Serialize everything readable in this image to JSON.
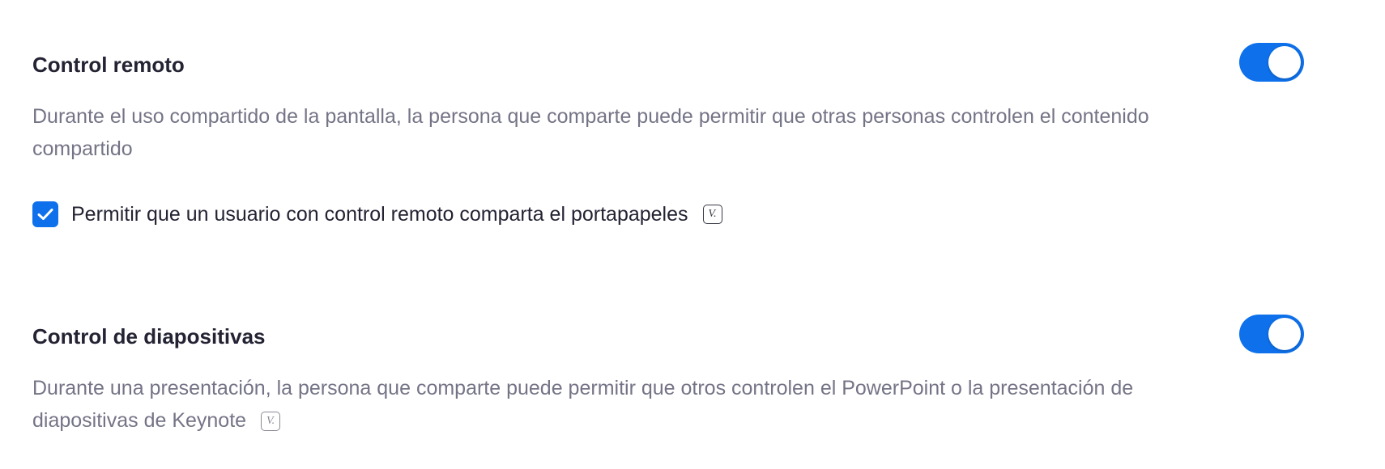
{
  "settings": [
    {
      "title": "Control remoto",
      "description": "Durante el uso compartido de la pantalla, la persona que comparte puede permitir que otras personas controlen el contenido compartido",
      "enabled": true,
      "suboption": {
        "label": "Permitir que un usuario con control remoto comparta el portapapeles",
        "checked": true,
        "icon": "version-lock-icon",
        "icon_text": "V."
      }
    },
    {
      "title": "Control de diapositivas",
      "description": "Durante una presentación, la persona que comparte puede permitir que otros controlen el PowerPoint o la presentación de diapositivas de Keynote",
      "enabled": true,
      "icon": "version-lock-icon",
      "icon_text": "V."
    }
  ],
  "colors": {
    "accent": "#0e71eb",
    "title": "#232333",
    "description": "#747487"
  }
}
